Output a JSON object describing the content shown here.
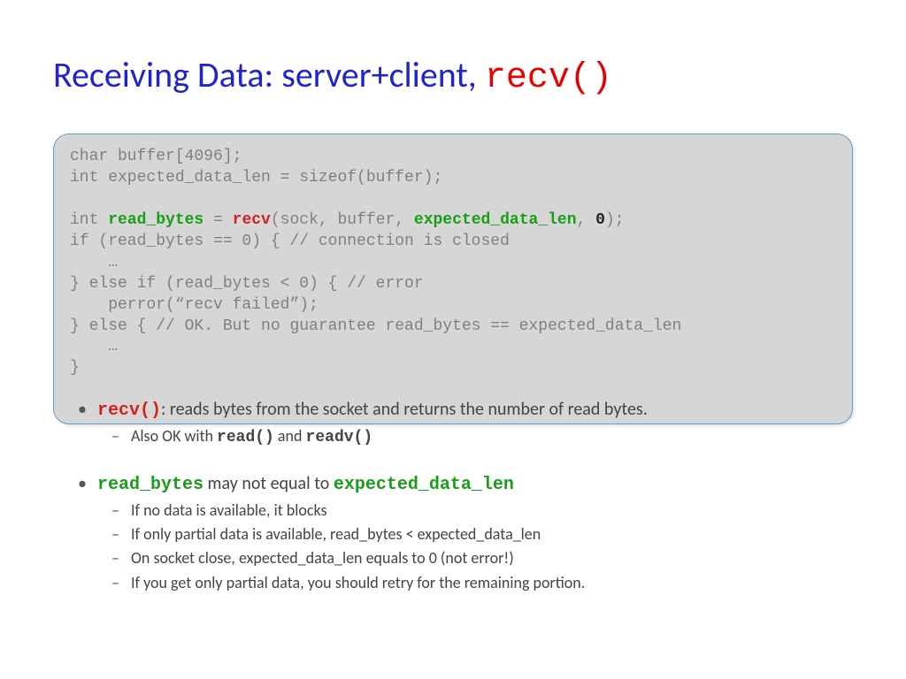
{
  "title": {
    "text": "Receiving Data: server+client, ",
    "code": "recv()"
  },
  "code": {
    "l1": "char buffer[4096];",
    "l2": "int expected_data_len = sizeof(buffer);",
    "l3": "",
    "l4a": "int ",
    "l4b": "read_bytes",
    "l4c": " = ",
    "l4d": "recv",
    "l4e": "(sock, buffer, ",
    "l4f": "expected_data_len",
    "l4g": ", ",
    "l4h": "0",
    "l4i": ");",
    "l5": "if (read_bytes == 0) { // connection is closed",
    "l6": "    …",
    "l7": "} else if (read_bytes < 0) { // error",
    "l8": "    perror(“recv failed”);",
    "l9": "} else { // OK. But no guarantee read_bytes == expected_data_len",
    "l10": "    …",
    "l11": "}"
  },
  "bullets": {
    "b1_a": "recv()",
    "b1_b": ": reads bytes from the socket and returns the number of read bytes.",
    "b1_sub1_a": "Also OK with ",
    "b1_sub1_b": "read()",
    "b1_sub1_c": " and ",
    "b1_sub1_d": "readv()",
    "b2_a": "read_bytes",
    "b2_b": "  may not equal to ",
    "b2_c": "expected_data_len",
    "b2_sub1": "If no data is available, it blocks",
    "b2_sub2": "If only partial data is available, read_bytes < expected_data_len",
    "b2_sub3": "On socket close, expected_data_len equals to 0 (not error!)",
    "b2_sub4": "If you get only partial data, you should retry for the remaining portion."
  }
}
